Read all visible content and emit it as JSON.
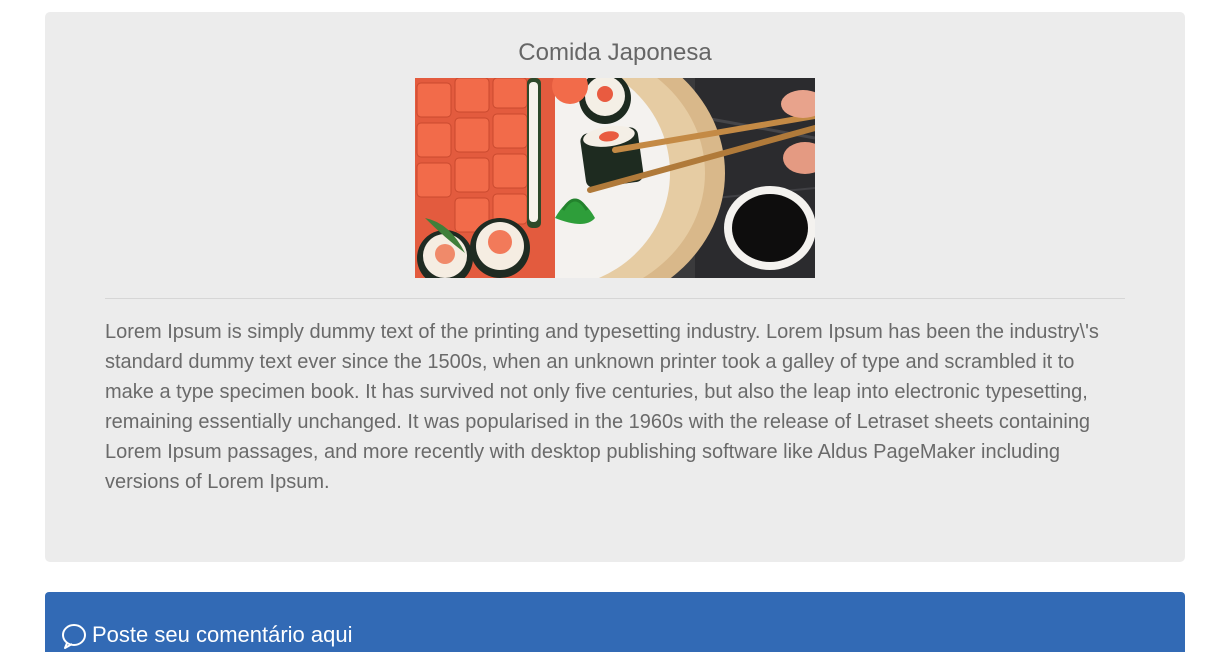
{
  "post": {
    "title": "Comida Japonesa",
    "image_alt": "sushi",
    "body": "Lorem Ipsum is simply dummy text of the printing and typesetting industry. Lorem Ipsum has been the industry\\'s standard dummy text ever since the 1500s, when an unknown printer took a galley of type and scrambled it to make a type specimen book. It has survived not only five centuries, but also the leap into electronic typesetting, remaining essentially unchanged. It was popularised in the 1960s with the release of Letraset sheets containing Lorem Ipsum passages, and more recently with desktop publishing software like Aldus PageMaker including versions of Lorem Ipsum."
  },
  "comments": {
    "icon": "comment-icon",
    "label": "Poste seu comentário aqui"
  },
  "colors": {
    "card_background": "#ececec",
    "comment_bar": "#326ab5",
    "text": "#6a6a6a"
  }
}
